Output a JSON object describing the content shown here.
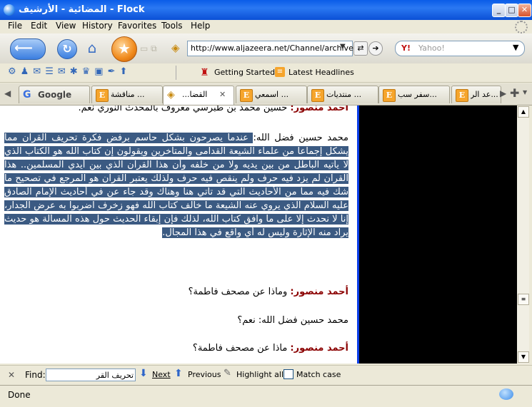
{
  "window": {
    "title": "المضائية - الأرشيف - Flock"
  },
  "menu": [
    "File",
    "Edit",
    "View",
    "History",
    "Favorites",
    "Tools",
    "Help"
  ],
  "nav": {
    "url": "http://www.aljazeera.net/Channel/archive,",
    "search_placeholder": "Yahoo!"
  },
  "bookmarks": {
    "getting_started": "Getting Started",
    "latest_headlines": "Latest Headlines"
  },
  "tabs": [
    {
      "label": "Google"
    },
    {
      "label": "مناقشة ..."
    },
    {
      "label": "...القضا"
    },
    {
      "label": "اسمعي ..."
    },
    {
      "label": "منتديات ..."
    },
    {
      "label": "سفر سب..."
    },
    {
      "label": "عد الر..."
    }
  ],
  "content": {
    "top_cut": {
      "speaker": "أحمد منصور:",
      "text": " حسين محمد بن طبرسي معروف بالمحدث النوري نعم."
    },
    "p1": {
      "speaker": "محمد حسين فضل الله:",
      "selected": " عندما يصرحون بشكل حاسم برفض فكرة تحريف القرآن مما يشكل إجماعا من علماء الشيعة القدامى والمتأخرين ويقولون إن كتاب الله هو الكتاب الذي لا يأتيه الباطل من بين يديه ولا من خلفه وأن هذا القرآن الذي بين أيدي المسلمين.. هذا القرآن لم يزد فيه حرف ولم ينقص فيه حرف ولذلك يعتبر القرآن هو المرجع في تصحيح ما شك فيه مما من الأحاديث التي قد تأتي هنا وهناك وقد جاء عن في أحاديث الإمام الصادق عليه السلام الذي يروي عنه الشيعة ما خالف كتاب الله فهو زخرف اضربوا به عرض الجدار، إنا لا نحدث إلا على ما وافق كتاب الله، لذلك فإن إبقاء الحديث حول هذه المسألة هو حديث يراد منه الإثارة وليس له أي واقع في هذا المجال."
    },
    "p2": {
      "speaker": "أحمد منصور:",
      "text": " وماذا عن مصحف فاطمة؟"
    },
    "p3": {
      "speaker": "محمد حسين فضل الله:",
      "text": " نعم؟"
    },
    "p4": {
      "speaker": "أحمد منصور:",
      "text": " ماذا عن مصحف فاطمة؟"
    }
  },
  "findbar": {
    "label": "Find:",
    "value": "تحريف القر",
    "next": "Next",
    "previous": "Previous",
    "highlight": "Highlight all",
    "matchcase": "Match case"
  },
  "status": {
    "text": "Done"
  },
  "colors": {
    "title_blue": "#0a5ce8",
    "selection": "#3b5a82",
    "speaker": "#8b0000"
  }
}
